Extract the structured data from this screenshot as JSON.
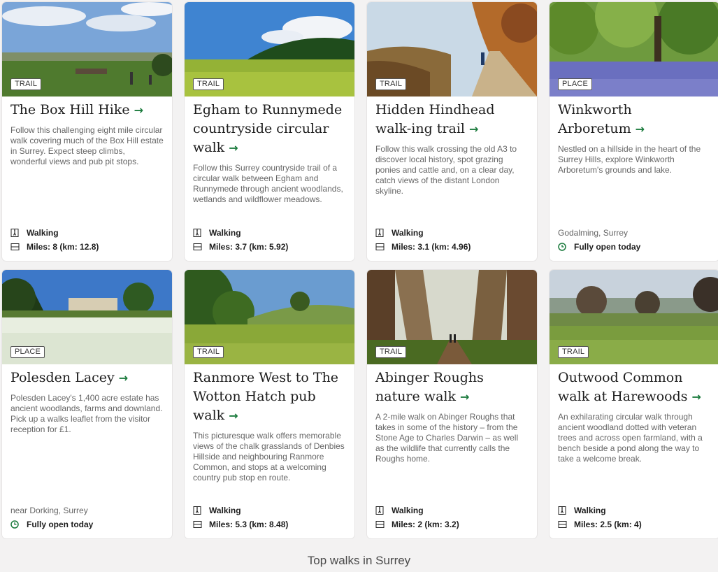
{
  "caption": "Top walks in Surrey",
  "colors": {
    "accent": "#1a7a3c",
    "card_bg": "#ffffff",
    "page_bg": "#f3f2f2"
  },
  "icons": {
    "arrow": "right-arrow-icon",
    "walking": "walking-person-icon",
    "distance": "ruler-icon",
    "open": "clock-icon"
  },
  "cards": [
    {
      "tag": "TRAIL",
      "title": "The Box Hill Hike",
      "arrow": "→",
      "description": "Follow this challenging eight mile circular walk covering much of the Box Hill estate in Surrey. Expect steep climbs, wonderful views and pub pit stops.",
      "activity": "Walking",
      "distance": "Miles: 8 (km: 12.8)"
    },
    {
      "tag": "TRAIL",
      "title": "Egham to Runnymede countryside circular walk",
      "arrow": "→",
      "description": "Follow this Surrey countryside trail of a circular walk between Egham and Runnymede through ancient woodlands, wetlands and wildflower meadows.",
      "activity": "Walking",
      "distance": "Miles: 3.7 (km: 5.92)"
    },
    {
      "tag": "TRAIL",
      "title": "Hidden Hindhead walk-ing trail",
      "arrow": "→",
      "description": "Follow this walk crossing the old A3 to discover local history, spot grazing ponies and cattle and, on a clear day, catch views of the distant London skyline.",
      "activity": "Walking",
      "distance": "Miles: 3.1 (km: 4.96)"
    },
    {
      "tag": "PLACE",
      "title": "Winkworth Arboretum",
      "arrow": "→",
      "description": "Nestled on a hillside in the heart of the Surrey Hills, explore Winkworth Arboretum's grounds and lake.",
      "location": "Godalming, Surrey",
      "status": "Fully open today"
    },
    {
      "tag": "PLACE",
      "title": "Polesden Lacey",
      "arrow": "→",
      "description": "Polesden Lacey's 1,400 acre estate has ancient woodlands, farms and downland. Pick up a walks leaflet from the visitor reception for £1.",
      "location": "near Dorking, Surrey",
      "status": "Fully open today"
    },
    {
      "tag": "TRAIL",
      "title": "Ranmore West to The Wotton Hatch pub walk",
      "arrow": "→",
      "description": "This picturesque walk offers memorable views of the chalk grasslands of Denbies Hillside and neighbouring Ranmore Common, and stops at a welcoming country pub stop en route.",
      "activity": "Walking",
      "distance": "Miles: 5.3 (km: 8.48)"
    },
    {
      "tag": "TRAIL",
      "title": "Abinger Roughs nature walk",
      "arrow": "→",
      "description": "A 2-mile walk on Abinger Roughs that takes in some of the history – from the Stone Age to Charles Darwin – as well as the wildlife that currently calls the Roughs home.",
      "activity": "Walking",
      "distance": "Miles: 2 (km: 3.2)"
    },
    {
      "tag": "TRAIL",
      "title": "Outwood Common walk at Harewoods",
      "arrow": "→",
      "description": "An exhilarating circular walk through ancient woodland dotted with veteran trees and across open farmland, with a bench beside a pond along the way to take a welcome break.",
      "activity": "Walking",
      "distance": "Miles: 2.5 (km: 4)"
    }
  ]
}
